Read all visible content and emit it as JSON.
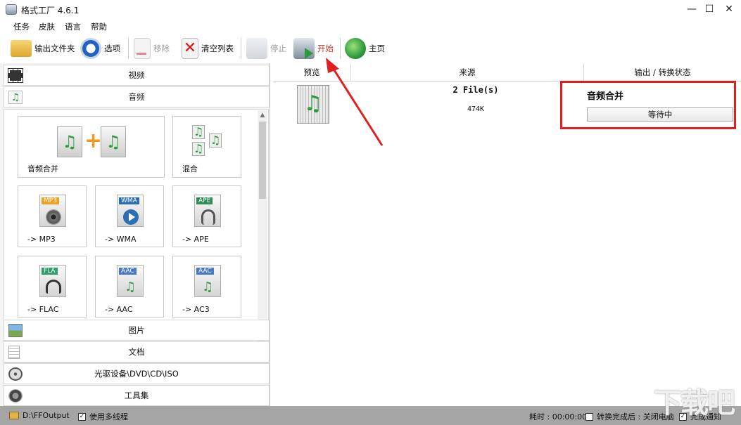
{
  "window": {
    "title": "格式工厂 4.6.1",
    "controls": [
      "—",
      "☐",
      "✕"
    ]
  },
  "menu": [
    "任务",
    "皮肤",
    "语言",
    "帮助"
  ],
  "toolbar": {
    "output_folder": "输出文件夹",
    "options": "选项",
    "remove": "移除",
    "clear_list": "清空列表",
    "stop": "停止",
    "start": "开始",
    "home": "主页"
  },
  "categories": {
    "video": "视频",
    "audio": "音频",
    "picture": "图片",
    "document": "文档",
    "optical": "光驱设备\\DVD\\CD\\ISO",
    "tools": "工具集"
  },
  "audio_tiles": [
    {
      "label": "音频合并",
      "icon": "audio-merge-icon"
    },
    {
      "label": "混合",
      "icon": "audio-mix-icon"
    },
    {
      "label": "-> MP3",
      "badge": "MP3",
      "badge_color": "#f0a020",
      "icon": "mp3-icon"
    },
    {
      "label": "-> WMA",
      "badge": "WMA",
      "badge_color": "#2a6fb6",
      "icon": "wma-icon"
    },
    {
      "label": "-> APE",
      "badge": "APE",
      "badge_color": "#2e8b57",
      "icon": "ape-icon"
    },
    {
      "label": "-> FLAC",
      "badge": "FLA",
      "badge_color": "#2ca06a",
      "icon": "flac-icon"
    },
    {
      "label": "-> AAC",
      "badge": "AAC",
      "badge_color": "#4a78c8",
      "icon": "aac-icon"
    },
    {
      "label": "-> AC3",
      "badge": "AAC",
      "badge_color": "#4a78c8",
      "icon": "ac3-icon"
    }
  ],
  "task_list": {
    "columns": [
      "预览",
      "来源",
      "输出 / 转换状态"
    ],
    "rows": [
      {
        "source": "2 File(s)",
        "size": "474K",
        "output": "音频合并",
        "status": "等待中"
      }
    ]
  },
  "statusbar": {
    "output_path": "D:\\FFOutput",
    "multithread": "使用多线程",
    "elapsed": "耗时 : 00:00:00",
    "after_convert": "转换完成后 : 关闭电脑",
    "notify": "完成通知"
  },
  "watermark": "下载吧",
  "colors": {
    "highlight": "#e02020",
    "arrow": "#e02020",
    "statusbar": "#a5a5a5"
  }
}
